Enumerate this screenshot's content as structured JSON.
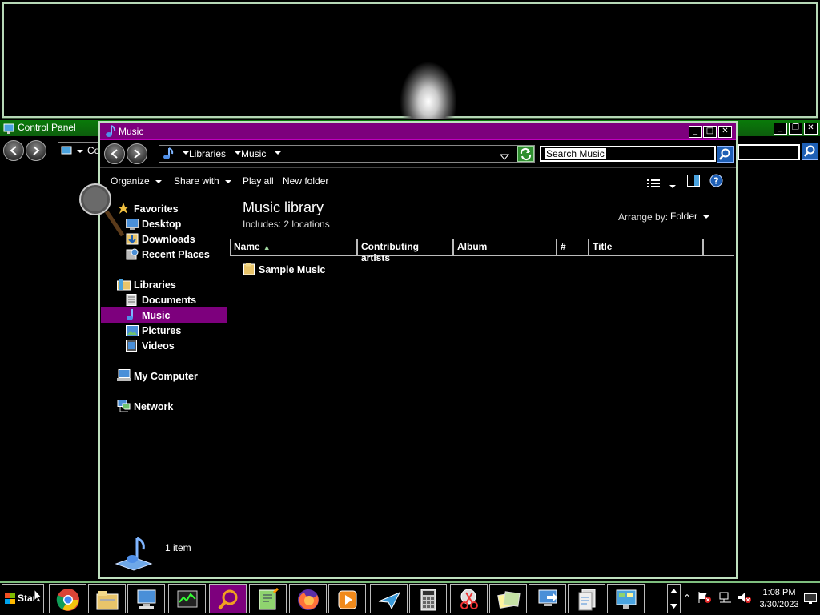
{
  "top_window": {},
  "control_panel": {
    "title": "Control Panel",
    "address_partial": "Co"
  },
  "music_window": {
    "title": "Music",
    "breadcrumb": [
      "Libraries",
      "Music"
    ],
    "search_placeholder": "Search Music",
    "toolbar": {
      "organize": "Organize",
      "share_with": "Share with",
      "play_all": "Play all",
      "new_folder": "New folder"
    },
    "library": {
      "heading": "Music library",
      "includes": "Includes: 2 locations",
      "arrange_label": "Arrange by:",
      "arrange_value": "Folder"
    },
    "columns": [
      "Name",
      "Contributing artists",
      "Album",
      "#",
      "Title"
    ],
    "items": [
      {
        "name": "Sample Music"
      }
    ],
    "nav": {
      "favorites": {
        "label": "Favorites",
        "items": [
          "Desktop",
          "Downloads",
          "Recent Places"
        ]
      },
      "libraries": {
        "label": "Libraries",
        "items": [
          "Documents",
          "Music",
          "Pictures",
          "Videos"
        ],
        "selected": "Music"
      },
      "computer": "My Computer",
      "network": "Network"
    },
    "status": "1 item"
  },
  "taskbar": {
    "start_label": "Start",
    "apps": [
      "chrome-icon",
      "file-explorer-icon",
      "computer-icon",
      "task-manager-icon",
      "magnifier-icon",
      "notepad-plus-plus-icon",
      "firefox-icon",
      "media-player-icon",
      "paper-plane-icon",
      "calculator-icon",
      "snipping-tool-icon",
      "sticky-notes-icon",
      "remote-desktop-icon",
      "documents-icon",
      "control-panel-icon"
    ],
    "active_app": "magnifier-icon",
    "time": "1:08 PM",
    "date": "3/30/2023"
  },
  "colors": {
    "title_accent": "#7d007d",
    "border_green": "#bfe0bf",
    "selection": "#7d007d"
  }
}
